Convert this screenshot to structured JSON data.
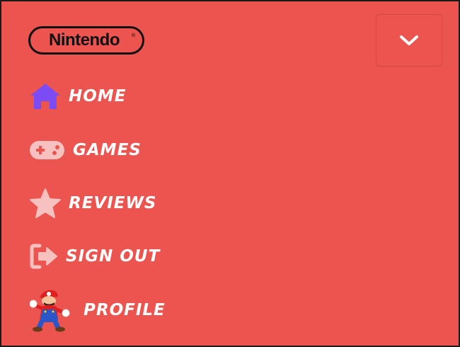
{
  "brand": {
    "logo_text": "Nintendo",
    "registered_mark": "®"
  },
  "menu_toggle": {
    "icon": "chevron-down-icon"
  },
  "nav": {
    "items": [
      {
        "label": "HOME",
        "icon": "home-icon",
        "icon_color": "#7b4cf5"
      },
      {
        "label": "GAMES",
        "icon": "gamepad-icon",
        "icon_color": "#f7c1c0"
      },
      {
        "label": "REVIEWS",
        "icon": "star-icon",
        "icon_color": "#f7c1c0"
      },
      {
        "label": "SIGN OUT",
        "icon": "sign-out-icon",
        "icon_color": "#f7c1c0"
      },
      {
        "label": "PROFILE",
        "icon": "mario-avatar"
      }
    ]
  },
  "colors": {
    "background": "#eb544f",
    "text": "#ffffff",
    "accent": "#7b4cf5",
    "soft_icon": "#f7c1c0"
  }
}
